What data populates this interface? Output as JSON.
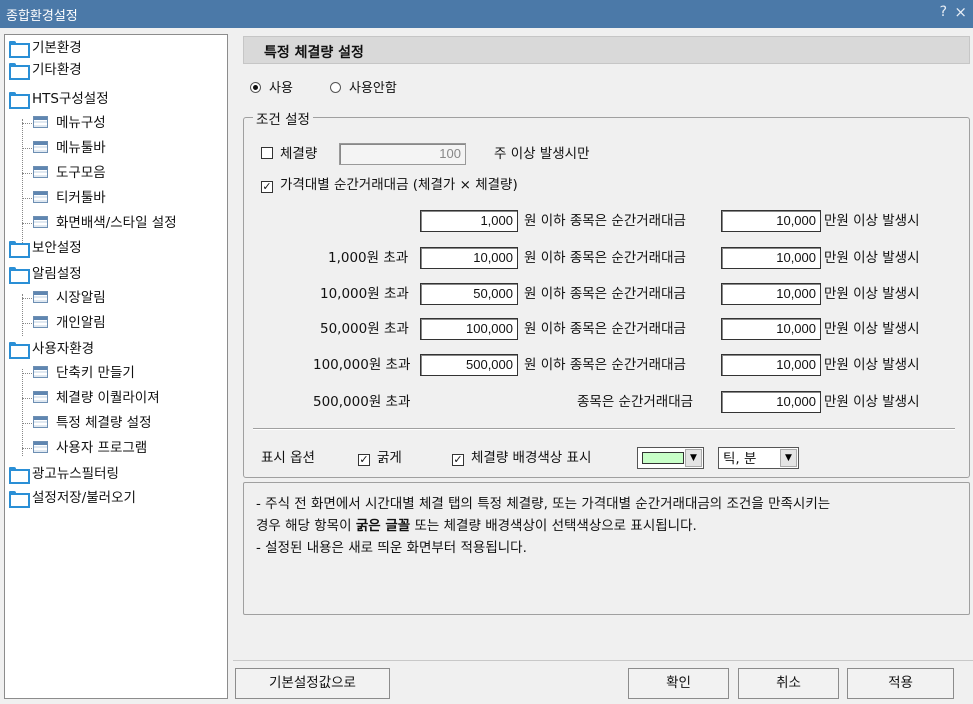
{
  "window": {
    "title": "종합환경설정",
    "help_glyph": "?",
    "close_glyph": "×"
  },
  "tree": {
    "items": [
      {
        "label": "기본환경",
        "type": "folder"
      },
      {
        "label": "기타환경",
        "type": "folder"
      },
      {
        "label": "HTS구성설정",
        "type": "folder"
      },
      {
        "label": "메뉴구성",
        "type": "page"
      },
      {
        "label": "메뉴툴바",
        "type": "page"
      },
      {
        "label": "도구모음",
        "type": "page"
      },
      {
        "label": "티커툴바",
        "type": "page"
      },
      {
        "label": "화면배색/스타일 설정",
        "type": "page"
      },
      {
        "label": "보안설정",
        "type": "folder"
      },
      {
        "label": "알림설정",
        "type": "folder"
      },
      {
        "label": "시장알림",
        "type": "page"
      },
      {
        "label": "개인알림",
        "type": "page"
      },
      {
        "label": "사용자환경",
        "type": "folder"
      },
      {
        "label": "단축키 만들기",
        "type": "page"
      },
      {
        "label": "체결량 이퀄라이져",
        "type": "page"
      },
      {
        "label": "특정 체결량 설정",
        "type": "page"
      },
      {
        "label": "사용자 프로그램",
        "type": "page"
      },
      {
        "label": "광고뉴스필터링",
        "type": "folder"
      },
      {
        "label": "설정저장/불러오기",
        "type": "folder"
      }
    ]
  },
  "panel": {
    "header": "특정 체결량 설정",
    "radio_use": "사용",
    "radio_nouse": "사용안함",
    "radio_selected": "사용",
    "group_title": "조건 설정",
    "volume": {
      "label": "체결량",
      "checked": false,
      "value": "100",
      "suffix": "주 이상 발생시만"
    },
    "price": {
      "label": "가격대별 순간거래대금 (체결가 × 체결량)",
      "checked": true
    },
    "rows": [
      {
        "prefix": "",
        "threshold": "1,000",
        "middle": "원 이하 종목은 순간거래대금",
        "amount": "10,000",
        "suffix": "만원 이상 발생시"
      },
      {
        "prefix": "1,000원 초과",
        "threshold": "10,000",
        "middle": "원 이하 종목은 순간거래대금",
        "amount": "10,000",
        "suffix": "만원 이상 발생시"
      },
      {
        "prefix": "10,000원 초과",
        "threshold": "50,000",
        "middle": "원 이하 종목은 순간거래대금",
        "amount": "10,000",
        "suffix": "만원 이상 발생시"
      },
      {
        "prefix": "50,000원 초과",
        "threshold": "100,000",
        "middle": "원 이하 종목은 순간거래대금",
        "amount": "10,000",
        "suffix": "만원 이상 발생시"
      },
      {
        "prefix": "100,000원 초과",
        "threshold": "500,000",
        "middle": "원 이하 종목은 순간거래대금",
        "amount": "10,000",
        "suffix": "만원 이상 발생시"
      },
      {
        "prefix": "500,000원 초과",
        "threshold": "",
        "middle": "종목은 순간거래대금",
        "amount": "10,000",
        "suffix": "만원 이상 발생시"
      }
    ],
    "display_options": {
      "label": "표시 옵션",
      "bold_label": "굵게",
      "bold_checked": true,
      "bg_label": "체결량 배경색상 표시",
      "bg_checked": true,
      "bg_color": "#c8ffc8",
      "unit_value": "틱, 분"
    },
    "description": {
      "line1": "- 주식 전 화면에서 시간대별 체결 탭의 특정 체결량, 또는 가격대별 순간거래대금의 조건을 만족시키는",
      "line2_a": "경우 해당 항목이 ",
      "line2_bold": "굵은 글꼴",
      "line2_b": " 또는 체결량 배경색상이 선택색상으로 표시됩니다.",
      "line3": "- 설정된 내용은 새로 띄운 화면부터 적용됩니다."
    }
  },
  "footer": {
    "defaults": "기본설정값으로",
    "ok": "확인",
    "cancel": "취소",
    "apply": "적용"
  }
}
